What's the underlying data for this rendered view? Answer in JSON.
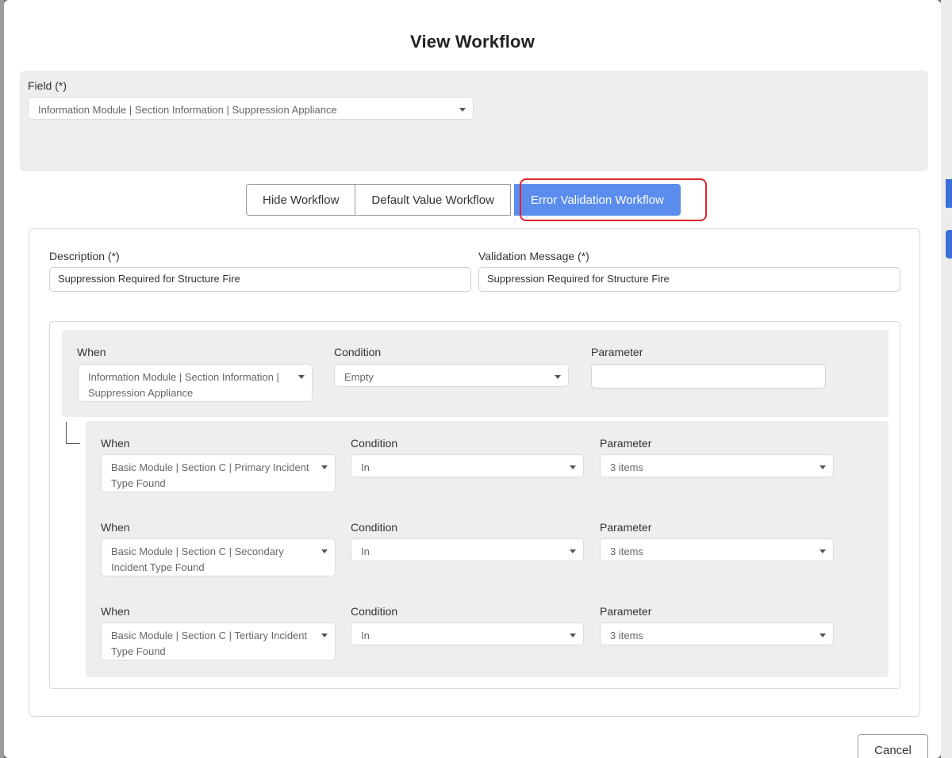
{
  "modal": {
    "title": "View Workflow"
  },
  "field_section": {
    "label": "Field (*)",
    "value": "Information Module | Section Information | Suppression Appliance"
  },
  "tabs": [
    {
      "label": "Hide Workflow",
      "active": false
    },
    {
      "label": "Default Value Workflow",
      "active": false
    },
    {
      "label": "Error Validation Workflow",
      "active": true
    }
  ],
  "form": {
    "description_label": "Description (*)",
    "description_value": "Suppression Required for Structure Fire",
    "validation_message_label": "Validation Message (*)",
    "validation_message_value": "Suppression Required for Structure Fire"
  },
  "root_condition": {
    "when_label": "When",
    "when_value": "Information Module | Section Information | Suppression Appliance",
    "condition_label": "Condition",
    "condition_value": "Empty",
    "parameter_label": "Parameter",
    "parameter_value": ""
  },
  "sub_conditions": [
    {
      "when_label": "When",
      "when_value": "Basic Module | Section C | Primary Incident Type Found",
      "condition_label": "Condition",
      "condition_value": "In",
      "parameter_label": "Parameter",
      "parameter_value": "3 items"
    },
    {
      "when_label": "When",
      "when_value": "Basic Module | Section C | Secondary Incident Type Found",
      "condition_label": "Condition",
      "condition_value": "In",
      "parameter_label": "Parameter",
      "parameter_value": "3 items"
    },
    {
      "when_label": "When",
      "when_value": "Basic Module | Section C | Tertiary Incident Type Found",
      "condition_label": "Condition",
      "condition_value": "In",
      "parameter_label": "Parameter",
      "parameter_value": "3 items"
    }
  ],
  "footer": {
    "cancel_label": "Cancel"
  },
  "colors": {
    "active_tab": "#5b8def",
    "highlight": "#e0252b",
    "panel_gray": "#eeeeee"
  }
}
